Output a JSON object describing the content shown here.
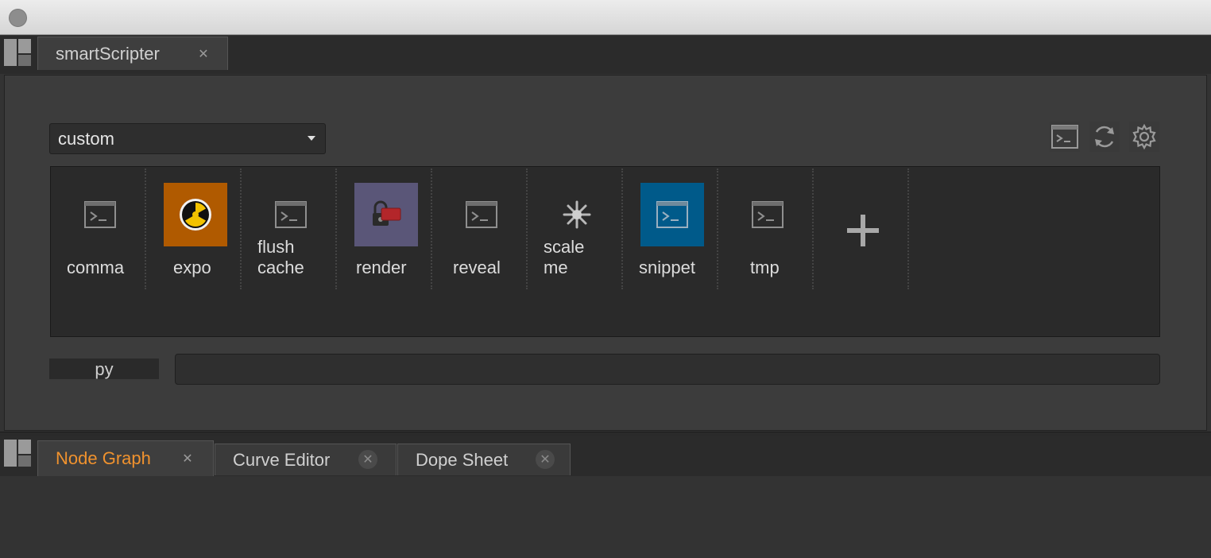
{
  "top_tabs": [
    {
      "label": "smartScripter",
      "close": "✕"
    }
  ],
  "toolbar": {
    "preset_value": "custom"
  },
  "commands": [
    {
      "label_lines": [
        "comma"
      ],
      "icon": "terminal-icon",
      "bg": ""
    },
    {
      "label_lines": [
        "expo"
      ],
      "icon": "nuclear-icon",
      "bg": "#b05a00"
    },
    {
      "label_lines": [
        "flush",
        "cache"
      ],
      "icon": "terminal-icon",
      "bg": ""
    },
    {
      "label_lines": [
        "render"
      ],
      "icon": "render-lock-icon",
      "bg": "#5a5678"
    },
    {
      "label_lines": [
        "reveal"
      ],
      "icon": "terminal-icon",
      "bg": ""
    },
    {
      "label_lines": [
        "scale",
        "me"
      ],
      "icon": "sparkle-icon",
      "bg": ""
    },
    {
      "label_lines": [
        "snippet"
      ],
      "icon": "terminal-icon",
      "bg": "#005a8a"
    },
    {
      "label_lines": [
        "tmp"
      ],
      "icon": "terminal-icon",
      "bg": ""
    }
  ],
  "add_button_icon": "plus-icon",
  "console": {
    "lang_label": "py",
    "value": ""
  },
  "bottom_tabs": [
    {
      "label": "Node Graph",
      "close": "✕"
    },
    {
      "label": "Curve Editor",
      "close": "✕"
    },
    {
      "label": "Dope Sheet",
      "close": "✕"
    }
  ],
  "colors": {
    "active_tab_text": "#f0922e",
    "expo_bg": "#b05a00",
    "render_bg": "#5a5678",
    "snippet_bg": "#005a8a"
  }
}
